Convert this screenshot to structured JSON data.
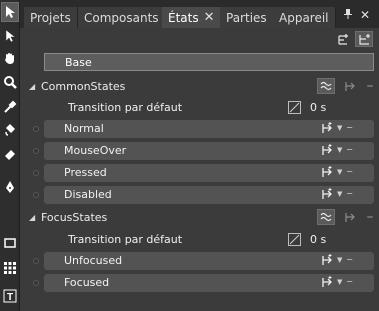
{
  "tabs": [
    {
      "label": "Projets",
      "active": false
    },
    {
      "label": "Composants",
      "active": false
    },
    {
      "label": "États",
      "active": true
    },
    {
      "label": "Parties",
      "active": false
    },
    {
      "label": "Appareil",
      "active": false
    }
  ],
  "base_label": "Base",
  "groups": [
    {
      "name": "CommonStates",
      "transition_label": "Transition par défaut",
      "transition_value": "0 s",
      "states": [
        "Normal",
        "MouseOver",
        "Pressed",
        "Disabled"
      ]
    },
    {
      "name": "FocusStates",
      "transition_label": "Transition par défaut",
      "transition_value": "0 s",
      "states": [
        "Unfocused",
        "Focused"
      ]
    }
  ],
  "icons": {
    "toolbar": [
      "selection-arrow-icon",
      "direct-select-icon",
      "pan-hand-icon",
      "zoom-icon",
      "eyedropper-icon",
      "paint-bucket-icon",
      "eraser-icon",
      "pen-icon",
      "rectangle-icon",
      "grid-icon",
      "text-icon"
    ],
    "tab_close": "close-icon",
    "pin": "pin-icon",
    "panel_close": "close-icon"
  }
}
